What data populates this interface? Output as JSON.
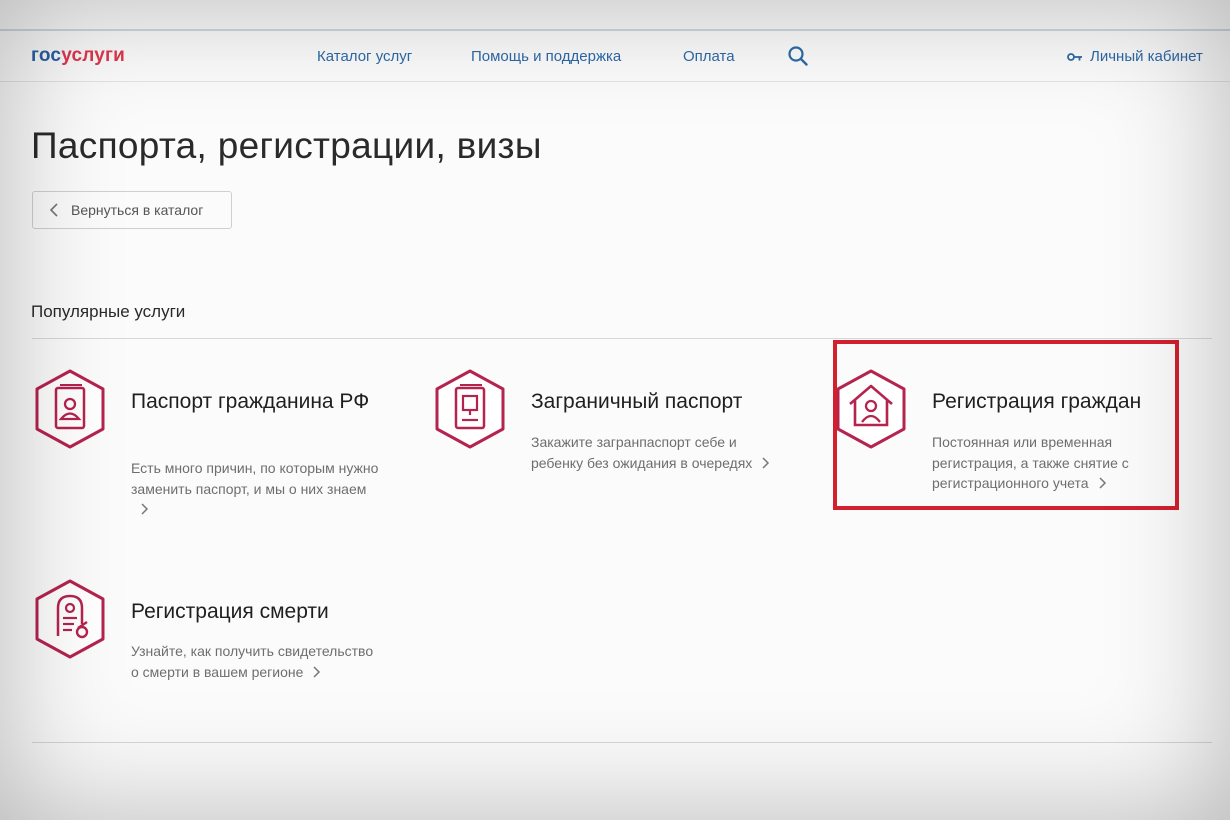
{
  "header": {
    "logo_part1": "гос",
    "logo_part2": "услуги",
    "nav": [
      {
        "label": "Каталог услуг"
      },
      {
        "label": "Помощь и поддержка"
      },
      {
        "label": "Оплата"
      }
    ],
    "search_icon": "search-icon",
    "account_icon": "key-icon",
    "account_label": "Личный кабинет"
  },
  "page": {
    "title": "Паспорта, регистрации, визы",
    "back_button_label": "Вернуться в каталог",
    "section_title": "Популярные услуги"
  },
  "cards": [
    {
      "icon": "passport-icon",
      "title": "Паспорт гражданина РФ",
      "description": "Есть много причин, по которым нужно заменить паспорт, и мы о них знаем"
    },
    {
      "icon": "foreign-passport-icon",
      "title": "Заграничный паспорт",
      "description": "Закажите загранпаспорт себе и ребенку без ожидания в очередях"
    },
    {
      "icon": "house-person-icon",
      "title": "Регистрация граждан",
      "description": "Постоянная или временная регистрация, а также снятие с регистрационного учета"
    },
    {
      "icon": "death-certificate-icon",
      "title": "Регистрация смерти",
      "description": "Узнайте, как получить свидетельство о смерти в вашем регионе"
    }
  ],
  "colors": {
    "brand_blue": "#2a5fa6",
    "brand_red": "#e0374f",
    "link_blue": "#2d6aa8",
    "icon_accent": "#b5234f",
    "highlight": "#d2202f"
  }
}
